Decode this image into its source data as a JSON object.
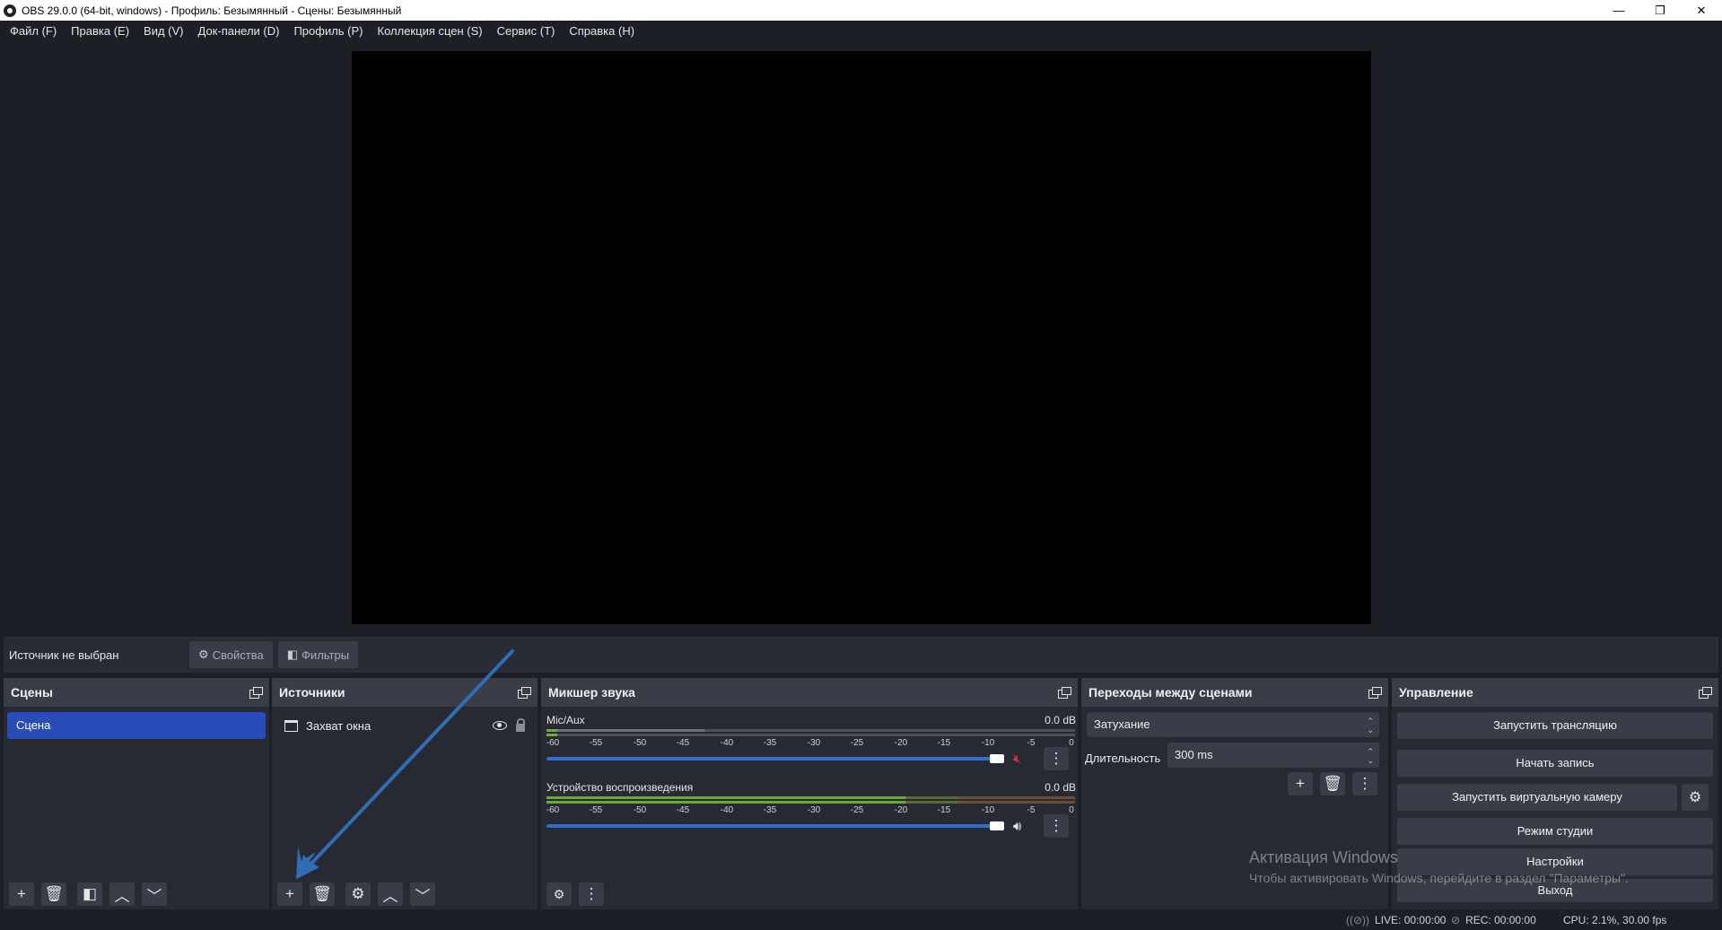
{
  "window": {
    "title": "OBS 29.0.0 (64-bit, windows) - Профиль: Безымянный - Сцены: Безымянный",
    "minimize": "—",
    "maximize": "❐",
    "close": "✕"
  },
  "menu": [
    {
      "label": "Файл (F)"
    },
    {
      "label": "Правка (E)"
    },
    {
      "label": "Вид (V)"
    },
    {
      "label": "Док-панели (D)"
    },
    {
      "label": "Профиль (P)"
    },
    {
      "label": "Коллекция сцен (S)"
    },
    {
      "label": "Сервис (T)"
    },
    {
      "label": "Справка (H)"
    }
  ],
  "context": {
    "label": "Источник не выбран",
    "properties": "Свойства",
    "filters": "Фильтры"
  },
  "scenes": {
    "title": "Сцены",
    "items": [
      "Сцена"
    ]
  },
  "sources": {
    "title": "Источники",
    "items": [
      "Захват окна"
    ]
  },
  "mixer": {
    "title": "Микшер звука",
    "scale": [
      "-60",
      "-55",
      "-50",
      "-45",
      "-40",
      "-35",
      "-30",
      "-25",
      "-20",
      "-15",
      "-10",
      "-5",
      "0"
    ],
    "channels": [
      {
        "name": "Mic/Aux",
        "level": "0.0 dB",
        "muted": true,
        "volume": 1.0
      },
      {
        "name": "Устройство воспроизведения",
        "level": "0.0 dB",
        "muted": false,
        "volume": 1.0
      }
    ]
  },
  "transitions": {
    "title": "Переходы между сценами",
    "type": "Затухание",
    "duration_label": "Длительность",
    "duration": "300 ms"
  },
  "controls": {
    "title": "Управление",
    "start_stream": "Запустить трансляцию",
    "start_record": "Начать запись",
    "virtual_cam": "Запустить виртуальную камеру",
    "studio_mode": "Режим студии",
    "settings": "Настройки",
    "exit": "Выход"
  },
  "watermark": {
    "title": "Активация Windows",
    "subtitle": "Чтобы активировать Windows, перейдите в раздел \"Параметры\"."
  },
  "status": {
    "live": "LIVE: 00:00:00",
    "rec": "REC: 00:00:00",
    "cpu": "CPU: 2.1%, 30.00 fps"
  },
  "colors": {
    "accent": "#284cb8",
    "background": "#1d1f26",
    "dock": "#272a33",
    "button": "#3a3d48",
    "mute_red": "#d6303a",
    "annotation_arrow": "#2f6db5"
  }
}
